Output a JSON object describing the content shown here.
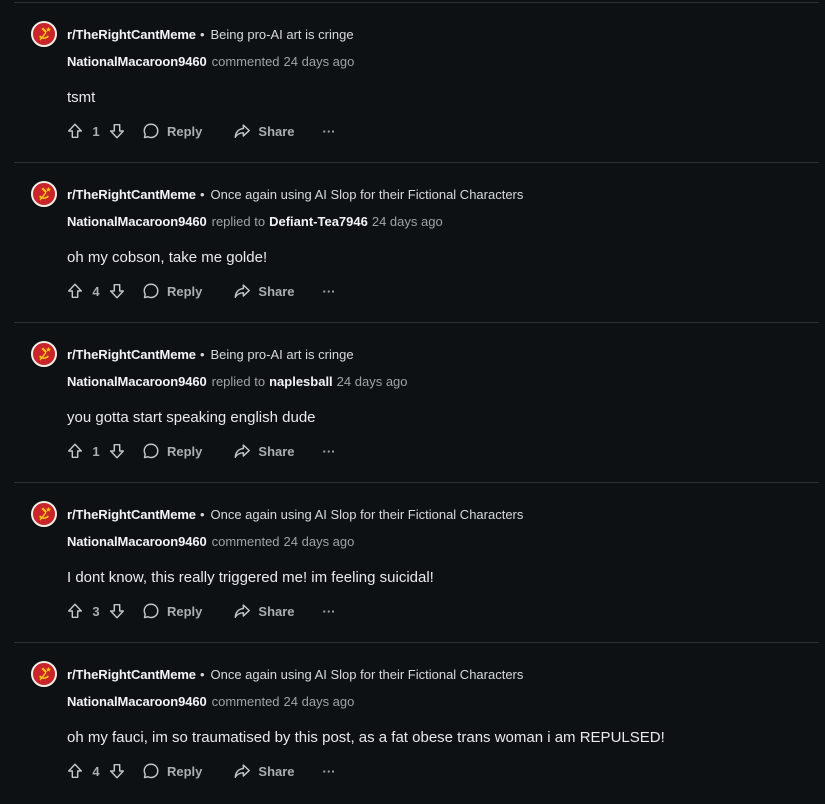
{
  "comments": [
    {
      "subreddit": "r/TheRightCantMeme",
      "post_title": "Being pro-AI art is cringe",
      "author": "NationalMacaroon9460",
      "action": "commented",
      "reply_to": "",
      "time": "24 days ago",
      "body": "tsmt",
      "score": "1"
    },
    {
      "subreddit": "r/TheRightCantMeme",
      "post_title": "Once again using AI Slop for their Fictional Characters",
      "author": "NationalMacaroon9460",
      "action": "replied to",
      "reply_to": "Defiant-Tea7946",
      "time": "24 days ago",
      "body": "oh my cobson, take me golde!",
      "score": "4"
    },
    {
      "subreddit": "r/TheRightCantMeme",
      "post_title": "Being pro-AI art is cringe",
      "author": "NationalMacaroon9460",
      "action": "replied to",
      "reply_to": "naplesball",
      "time": "24 days ago",
      "body": "you gotta start speaking english dude",
      "score": "1"
    },
    {
      "subreddit": "r/TheRightCantMeme",
      "post_title": "Once again using AI Slop for their Fictional Characters",
      "author": "NationalMacaroon9460",
      "action": "commented",
      "reply_to": "",
      "time": "24 days ago",
      "body": "I dont know, this really triggered me! im feeling suicidal!",
      "score": "3"
    },
    {
      "subreddit": "r/TheRightCantMeme",
      "post_title": "Once again using AI Slop for their Fictional Characters",
      "author": "NationalMacaroon9460",
      "action": "commented",
      "reply_to": "",
      "time": "24 days ago",
      "body": "oh my fauci, im so traumatised by this post, as a fat obese trans woman i am REPULSED!",
      "score": "4"
    }
  ],
  "labels": {
    "bullet": "•",
    "reply": "Reply",
    "share": "Share",
    "more": "···"
  },
  "icons": {
    "avatar": "subreddit-avatar-icon",
    "upvote": "upvote-icon",
    "downvote": "downvote-icon",
    "reply": "comment-bubble-icon",
    "share": "share-arrow-icon",
    "more": "more-options-icon"
  },
  "colors": {
    "background": "#0e1113",
    "avatar_red": "#c8262b",
    "avatar_gold": "#f5c518",
    "divider": "#2a3236",
    "muted_text": "#9ea3a7"
  }
}
